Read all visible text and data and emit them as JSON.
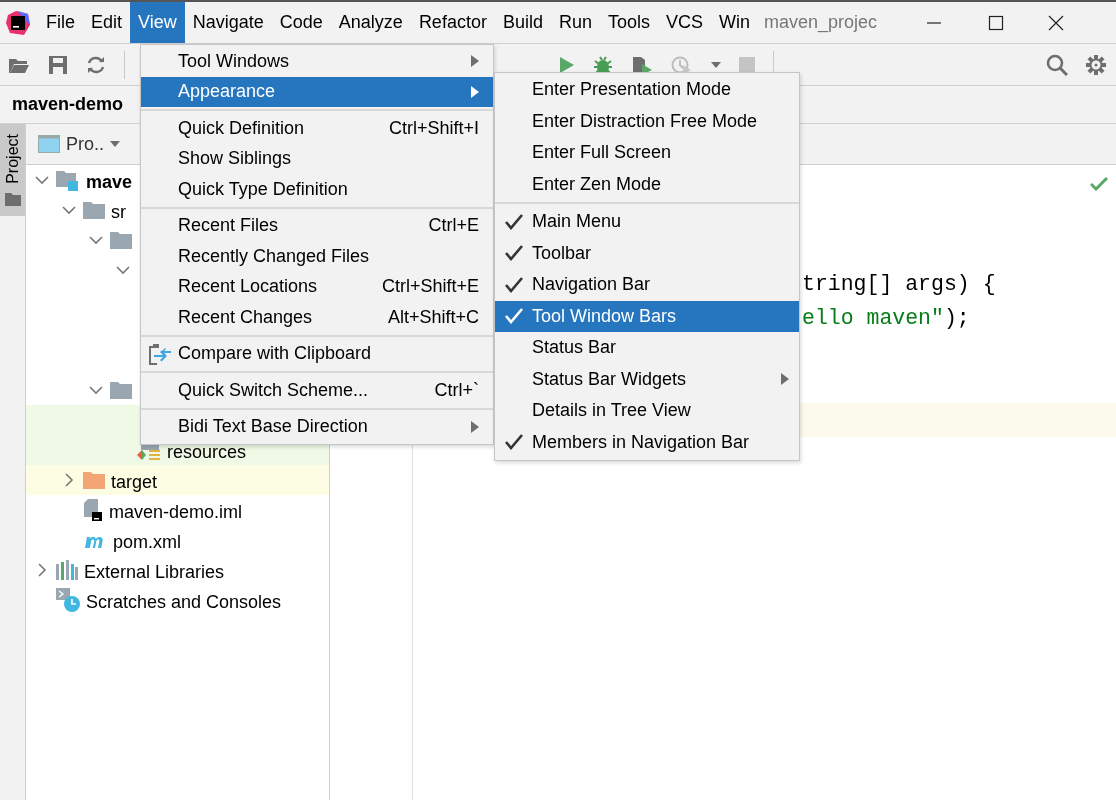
{
  "title_bar": {
    "project_title": "maven_projec"
  },
  "menu_bar": [
    {
      "label": "File",
      "selected": false
    },
    {
      "label": "Edit",
      "selected": false
    },
    {
      "label": "View",
      "selected": true
    },
    {
      "label": "Navigate",
      "selected": false
    },
    {
      "label": "Code",
      "selected": false
    },
    {
      "label": "Analyze",
      "selected": false
    },
    {
      "label": "Refactor",
      "selected": false
    },
    {
      "label": "Build",
      "selected": false
    },
    {
      "label": "Run",
      "selected": false
    },
    {
      "label": "Tools",
      "selected": false
    },
    {
      "label": "VCS",
      "selected": false
    },
    {
      "label": "Win",
      "selected": false
    }
  ],
  "navigation_bar": {
    "crumb": "maven-demo"
  },
  "tool_window_stripe": [
    {
      "label": "Project",
      "selected": true
    }
  ],
  "project_panel": {
    "view_selector": "Pro..",
    "tree": [
      {
        "label": "mave",
        "kind": "module",
        "expanded": true,
        "children": [
          {
            "label": "sr",
            "kind": "folder",
            "expanded": true,
            "children": [
              {
                "kind": "folder",
                "expanded": true,
                "children": [
                  {
                    "expanded": true
                  }
                ]
              },
              {
                "kind": "folder",
                "expanded": true,
                "children": [
                  {
                    "color": "#eff9e6"
                  },
                  {
                    "label": "resources",
                    "kind": "resources",
                    "color": "#eff9e6"
                  }
                ]
              }
            ]
          },
          {
            "label": "target",
            "kind": "excluded",
            "expanded": false,
            "color": "#fdfde3"
          },
          {
            "label": "maven-demo.iml",
            "kind": "iml"
          },
          {
            "label": "pom.xml",
            "kind": "maven"
          }
        ]
      },
      {
        "label": "External Libraries",
        "kind": "libraries",
        "expanded": false
      },
      {
        "label": "Scratches and Consoles",
        "kind": "scratches"
      }
    ]
  },
  "editor": {
    "lines": [
      {
        "segments": [
          {
            "text": "tring[] args) {",
            "kind": "plain"
          }
        ]
      },
      {
        "segments": [
          {
            "text": "ello maven\"",
            "kind": "string"
          },
          {
            "text": ");",
            "kind": "plain"
          }
        ]
      }
    ]
  },
  "view_menu": {
    "items": [
      {
        "kind": "item",
        "label": "Tool Windows",
        "submenu": true,
        "selected": false
      },
      {
        "kind": "item",
        "label": "Appearance",
        "submenu": true,
        "selected": true
      },
      {
        "kind": "separator"
      },
      {
        "kind": "item",
        "label": "Quick Definition",
        "shortcut": "Ctrl+Shift+I",
        "selected": false
      },
      {
        "kind": "item",
        "label": "Show Siblings",
        "selected": false
      },
      {
        "kind": "item",
        "label": "Quick Type Definition",
        "selected": false
      },
      {
        "kind": "separator"
      },
      {
        "kind": "item",
        "label": "Recent Files",
        "shortcut": "Ctrl+E",
        "selected": false
      },
      {
        "kind": "item",
        "label": "Recently Changed Files",
        "selected": false
      },
      {
        "kind": "item",
        "label": "Recent Locations",
        "shortcut": "Ctrl+Shift+E",
        "selected": false
      },
      {
        "kind": "item",
        "label": "Recent Changes",
        "shortcut": "Alt+Shift+C",
        "selected": false
      },
      {
        "kind": "separator"
      },
      {
        "kind": "icon_item",
        "label": "Compare with Clipboard",
        "selected": false
      },
      {
        "kind": "separator"
      },
      {
        "kind": "item",
        "label": "Quick Switch Scheme...",
        "shortcut": "Ctrl+`",
        "selected": false
      },
      {
        "kind": "separator"
      },
      {
        "kind": "item",
        "label": "Bidi Text Base Direction",
        "submenu": true,
        "selected": false
      }
    ]
  },
  "appearance_submenu": {
    "items": [
      {
        "kind": "item",
        "label": "Enter Presentation Mode",
        "checked": false,
        "selected": false
      },
      {
        "kind": "item",
        "label": "Enter Distraction Free Mode",
        "checked": false,
        "selected": false
      },
      {
        "kind": "item",
        "label": "Enter Full Screen",
        "checked": false,
        "selected": false
      },
      {
        "kind": "item",
        "label": "Enter Zen Mode",
        "checked": false,
        "selected": false
      },
      {
        "kind": "separator"
      },
      {
        "kind": "item",
        "label": "Main Menu",
        "checked": true,
        "selected": false
      },
      {
        "kind": "item",
        "label": "Toolbar",
        "checked": true,
        "selected": false
      },
      {
        "kind": "item",
        "label": "Navigation Bar",
        "checked": true,
        "selected": false
      },
      {
        "kind": "item",
        "label": "Tool Window Bars",
        "checked": true,
        "selected": true
      },
      {
        "kind": "item",
        "label": "Status Bar",
        "checked": false,
        "selected": false
      },
      {
        "kind": "item",
        "label": "Status Bar Widgets",
        "checked": false,
        "selected": false,
        "submenu": true
      },
      {
        "kind": "item",
        "label": "Details in Tree View",
        "checked": false,
        "selected": false
      },
      {
        "kind": "item",
        "label": "Members in Navigation Bar",
        "checked": true,
        "selected": false
      }
    ]
  }
}
